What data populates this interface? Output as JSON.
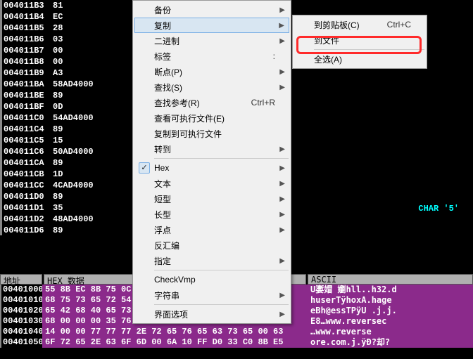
{
  "disasm": {
    "rows": [
      {
        "addr": "004011B3",
        "bytes": "81"
      },
      {
        "addr": "004011B4",
        "bytes": "EC"
      },
      {
        "addr": "004011B5",
        "bytes": "28"
      },
      {
        "addr": "004011B6",
        "bytes": "03"
      },
      {
        "addr": "004011B7",
        "bytes": "00"
      },
      {
        "addr": "004011B8",
        "bytes": "00"
      },
      {
        "addr": "004011B9",
        "bytes": "A3"
      },
      {
        "addr": "004011BA",
        "bytes": "58AD4000"
      },
      {
        "addr": "004011BE",
        "bytes": "89"
      },
      {
        "addr": "004011BF",
        "bytes": "0D"
      },
      {
        "addr": "004011C0",
        "bytes": "54AD4000"
      },
      {
        "addr": "004011C4",
        "bytes": "89"
      },
      {
        "addr": "004011C5",
        "bytes": "15"
      },
      {
        "addr": "004011C6",
        "bytes": "50AD4000"
      },
      {
        "addr": "004011CA",
        "bytes": "89"
      },
      {
        "addr": "004011CB",
        "bytes": "1D"
      },
      {
        "addr": "004011CC",
        "bytes": "4CAD4000"
      },
      {
        "addr": "004011D0",
        "bytes": "89"
      },
      {
        "addr": "004011D1",
        "bytes": "35"
      },
      {
        "addr": "004011D2",
        "bytes": "48AD4000"
      },
      {
        "addr": "004011D6",
        "bytes": "89"
      }
    ],
    "comment": "CHAR '5'"
  },
  "dump": {
    "headers": {
      "addr": "地址",
      "hex": "HEX 数据",
      "ascii": "ASCII"
    },
    "rows": [
      {
        "addr": "00401000",
        "hex": "55 8B EC 8B 75 0C 56 FF 15 10 60 40 00 33 C0 A3",
        "ascii": "U嬱媢 嬼hll..h32.d"
      },
      {
        "addr": "00401010",
        "hex": "68 75 73 65 72 54 FF 68 6F 78 41 00 68 61 67 65",
        "ascii": "huserTÿhoxA.hage"
      },
      {
        "addr": "00401020",
        "hex": "65 42 68 40 65 73 73 54 50 FF 55 0C 6A 00 6A 00",
        "ascii": "eBh@essTPÿU .j.j."
      },
      {
        "addr": "00401030",
        "hex": "68 00 00 00 35 76 65 77 77 72 65 43 6F 00 00 00",
        "ascii": "E8…www.reversec"
      },
      {
        "addr": "00401040",
        "hex": "14 00 00 77 77 77 2E 72 65 76 65 63 73 65 00 63",
        "ascii": "…www.reverse"
      },
      {
        "addr": "00401050",
        "hex": "6F 72 65 2E 63 6F 6D 00 6A 10 FF D0 33 C0 8B E5",
        "ascii": "ore.com.j.ÿÐ?却?"
      }
    ]
  },
  "menu1": {
    "items": [
      {
        "label": "备份",
        "arrow": true
      },
      {
        "label": "复制",
        "arrow": true,
        "hl": true
      },
      {
        "label": "二进制",
        "arrow": true
      },
      {
        "label": "标签",
        "suffix": ":"
      },
      {
        "label": "断点(P)",
        "arrow": true
      },
      {
        "label": "查找(S)",
        "arrow": true
      },
      {
        "label": "查找参考(R)",
        "shortcut": "Ctrl+R"
      },
      {
        "label": "查看可执行文件(E)"
      },
      {
        "label": "复制到可执行文件"
      },
      {
        "label": "转到",
        "arrow": true
      },
      {
        "sep": true
      },
      {
        "label": "Hex",
        "arrow": true,
        "check": true
      },
      {
        "label": "文本",
        "arrow": true
      },
      {
        "label": "短型",
        "arrow": true
      },
      {
        "label": "长型",
        "arrow": true
      },
      {
        "label": "浮点",
        "arrow": true
      },
      {
        "label": "反汇编"
      },
      {
        "label": "指定",
        "arrow": true
      },
      {
        "sep": true
      },
      {
        "label": "CheckVmp"
      },
      {
        "label": "字符串",
        "arrow": true
      },
      {
        "sep": true
      },
      {
        "label": "界面选项",
        "arrow": true
      }
    ]
  },
  "menu2": {
    "items": [
      {
        "label": "到剪贴板(C)",
        "shortcut": "Ctrl+C"
      },
      {
        "label": "到文件"
      },
      {
        "sep": true
      },
      {
        "label": "全选(A)"
      }
    ]
  }
}
